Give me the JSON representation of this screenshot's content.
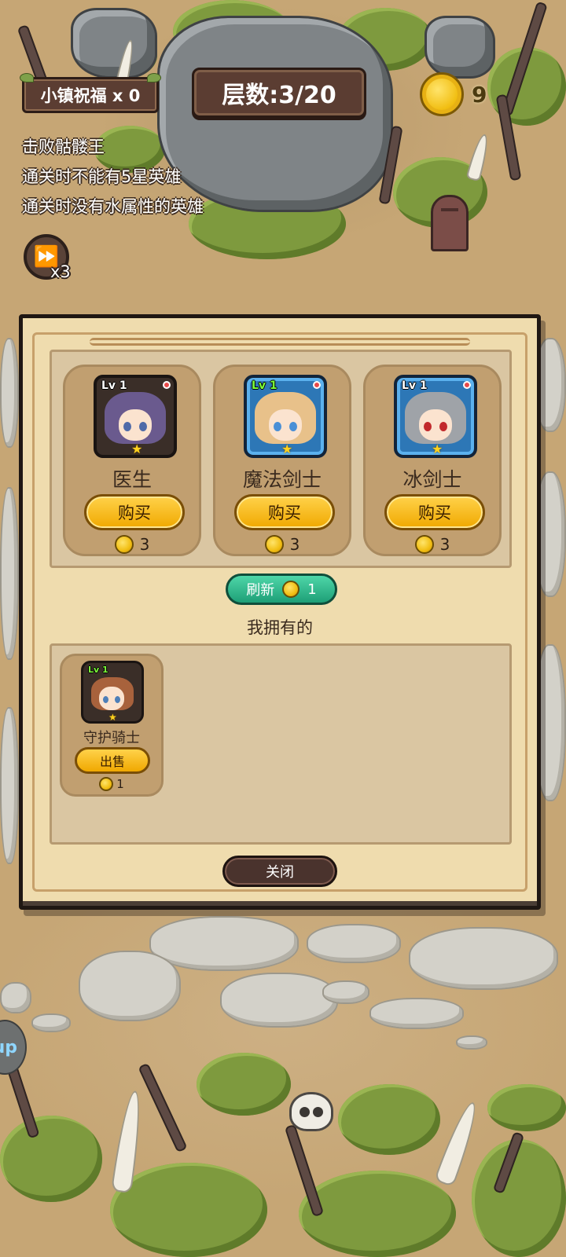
{
  "hud": {
    "blessing_label": "小镇祝福 x 0",
    "floor_label": "层数:3/20",
    "gold_count": "9"
  },
  "objectives": [
    "击败骷髅王",
    "通关时不能有5星英雄",
    "通关时没有水属性的英雄"
  ],
  "speed": {
    "icon": "fast-forward-icon",
    "label": "x3"
  },
  "side_tab_label": "up",
  "shop": {
    "offers": [
      {
        "name": "医生",
        "level": "Lv 1",
        "buy_label": "购买",
        "price": "3",
        "stars": 1,
        "frame_color": "#3a2e28"
      },
      {
        "name": "魔法剑士",
        "level": "Lv 1",
        "buy_label": "购买",
        "price": "3",
        "stars": 1,
        "frame_color": "#2d77b6"
      },
      {
        "name": "冰剑士",
        "level": "Lv 1",
        "buy_label": "购买",
        "price": "3",
        "stars": 1,
        "frame_color": "#2d77b6"
      }
    ],
    "refresh_label": "刷新",
    "refresh_cost": "1",
    "owned_title": "我拥有的",
    "owned": [
      {
        "name": "守护骑士",
        "level": "Lv 1",
        "sell_label": "出售",
        "price": "1",
        "stars": 1
      }
    ],
    "close_label": "关闭"
  },
  "colors": {
    "button_gold": "#f0a800",
    "refresh_green": "#1e9f77",
    "panel_parchment": "#efdcae",
    "hud_brown": "#5b3d32"
  }
}
